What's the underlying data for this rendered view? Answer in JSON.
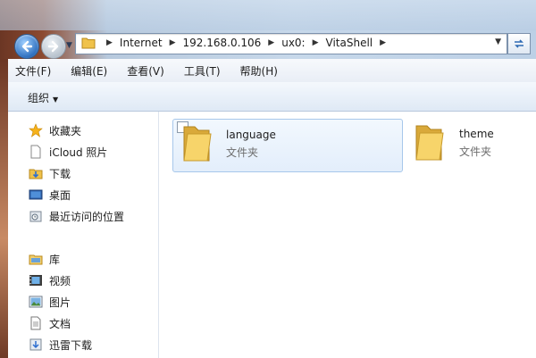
{
  "address": {
    "crumbs": [
      "Internet",
      "192.168.0.106",
      "ux0:",
      "VitaShell"
    ]
  },
  "menu": [
    "文件(F)",
    "编辑(E)",
    "查看(V)",
    "工具(T)",
    "帮助(H)"
  ],
  "toolbar": {
    "organize": "组织"
  },
  "nav": {
    "favorites": {
      "title": "收藏夹",
      "items": [
        {
          "label": "iCloud 照片",
          "icon": "icloud-doc-icon"
        },
        {
          "label": "下载",
          "icon": "download-folder-icon"
        },
        {
          "label": "桌面",
          "icon": "desktop-icon"
        },
        {
          "label": "最近访问的位置",
          "icon": "recent-places-icon"
        }
      ]
    },
    "libraries": {
      "title": "库",
      "items": [
        {
          "label": "视频",
          "icon": "video-library-icon"
        },
        {
          "label": "图片",
          "icon": "picture-library-icon"
        },
        {
          "label": "文档",
          "icon": "document-library-icon"
        },
        {
          "label": "迅雷下载",
          "icon": "thunder-download-icon"
        }
      ]
    }
  },
  "files": [
    {
      "name": "language",
      "type": "文件夹",
      "selected": true
    },
    {
      "name": "theme",
      "type": "文件夹",
      "selected": false
    }
  ],
  "colors": {
    "selection_border": "#a7c7eb",
    "folder": "#f5c94a"
  }
}
